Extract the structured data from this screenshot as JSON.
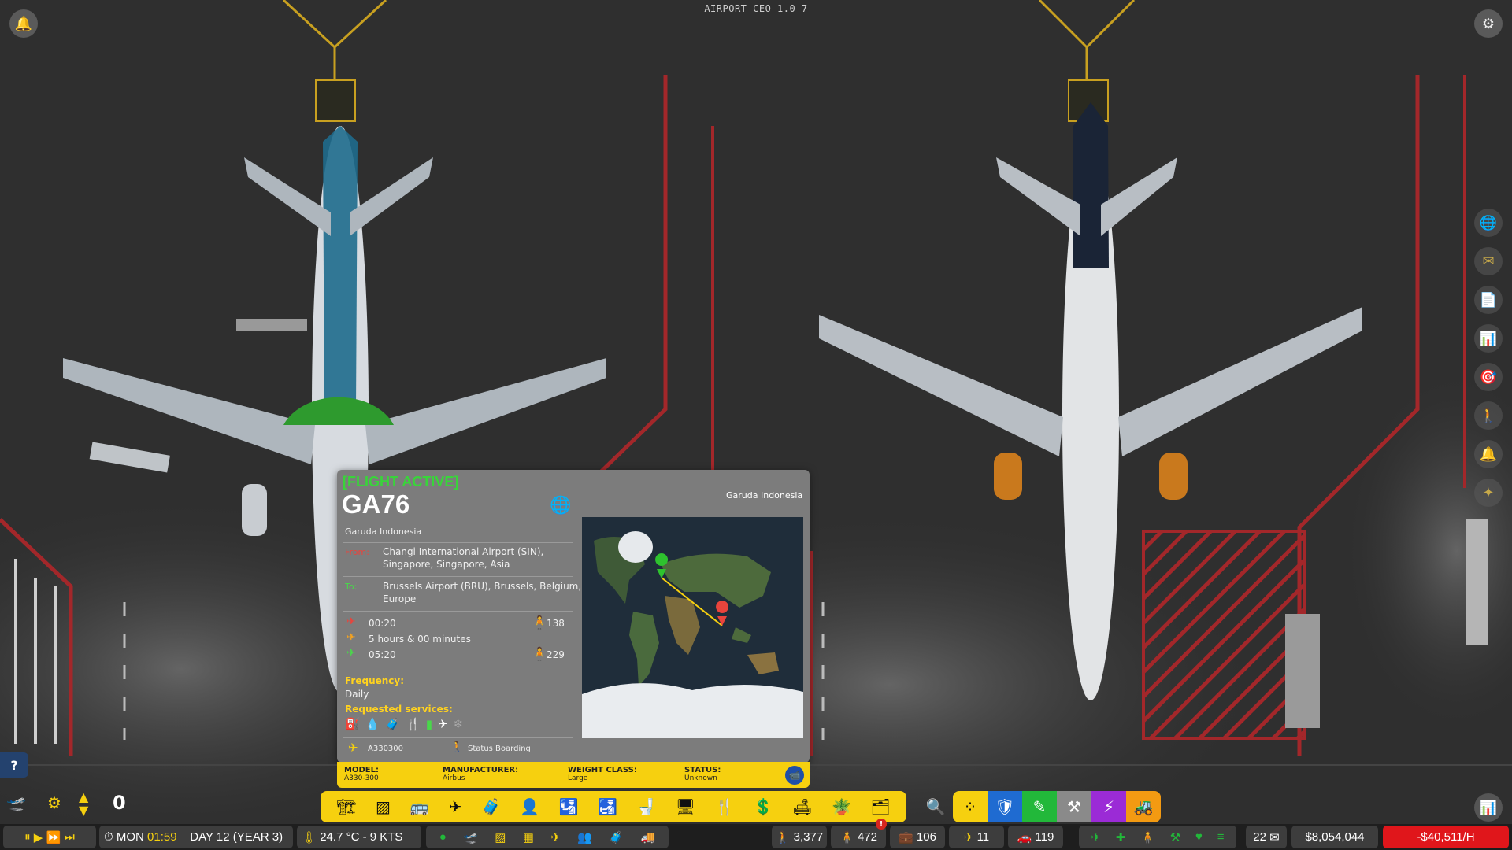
{
  "app": {
    "title": "AIRPORT CEO 1.0-7"
  },
  "flight_panel": {
    "status": "[FLIGHT ACTIVE]",
    "code": "GA76",
    "airline": "Garuda Indonesia",
    "logo_text": "Garuda Indonesia",
    "from_label": "From:",
    "from_line1": "Changi International Airport (SIN),",
    "from_line2": "Singapore, Singapore, Asia",
    "to_label": "To:",
    "to_line1": "Brussels Airport (BRU), Brussels, Belgium,",
    "to_line2": "Europe",
    "departure": "00:20",
    "duration": "5 hours & 00 minutes",
    "arrival": "05:20",
    "pax_out": "138",
    "pax_in": "229",
    "frequency_label": "Frequency:",
    "frequency_value": "Daily",
    "services_label": "Requested services:",
    "aircraft": "A330300",
    "status_text": "Status Boarding",
    "info": {
      "model_label": "MODEL:",
      "model_value": "A330-300",
      "manufacturer_label": "MANUFACTURER:",
      "manufacturer_value": "Airbus",
      "weight_label": "WEIGHT CLASS:",
      "weight_value": "Large",
      "status_label": "STATUS:",
      "status_value": "Unknown"
    }
  },
  "speed_indicator": "0",
  "bottom": {
    "day": "MON",
    "time": "01:59",
    "date": "DAY 12 (YEAR 3)",
    "weather": "24.7 °C - 9 KTS",
    "passengers": "3,377",
    "staff": "472",
    "alert_badge": "!",
    "bags": "106",
    "flights": "11",
    "vehicles": "119",
    "mail": "22",
    "money": "$8,054,044",
    "income": "-$40,511/H"
  },
  "help_label": "?"
}
